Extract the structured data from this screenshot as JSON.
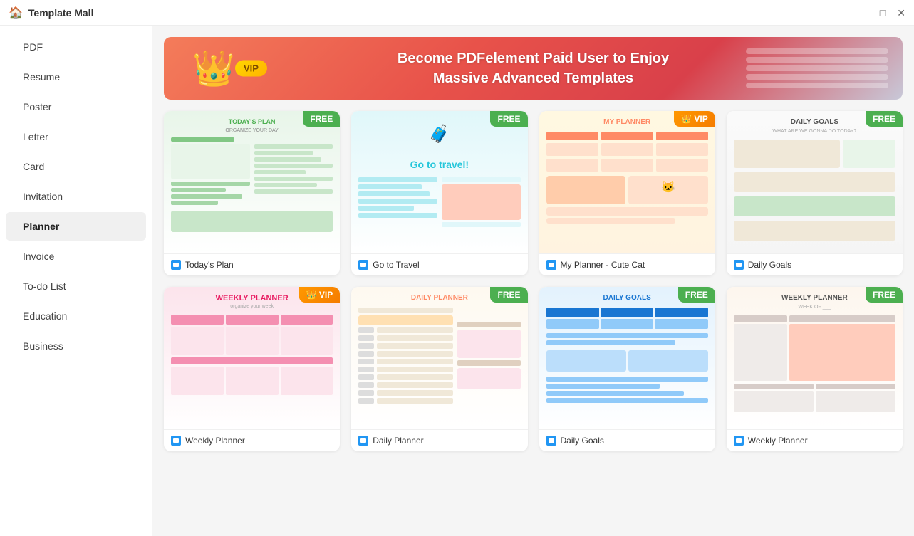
{
  "titlebar": {
    "title": "Template Mall",
    "icon": "🏠",
    "minimize": "—",
    "maximize": "□",
    "close": "✕"
  },
  "sidebar": {
    "items": [
      {
        "id": "pdf",
        "label": "PDF",
        "active": false
      },
      {
        "id": "resume",
        "label": "Resume",
        "active": false
      },
      {
        "id": "poster",
        "label": "Poster",
        "active": false
      },
      {
        "id": "letter",
        "label": "Letter",
        "active": false
      },
      {
        "id": "card",
        "label": "Card",
        "active": false
      },
      {
        "id": "invitation",
        "label": "Invitation",
        "active": false
      },
      {
        "id": "planner",
        "label": "Planner",
        "active": true
      },
      {
        "id": "invoice",
        "label": "Invoice",
        "active": false
      },
      {
        "id": "todo",
        "label": "To-do List",
        "active": false
      },
      {
        "id": "education",
        "label": "Education",
        "active": false
      },
      {
        "id": "business",
        "label": "Business",
        "active": false
      }
    ]
  },
  "banner": {
    "text_line1": "Become PDFelement Paid User to Enjoy",
    "text_line2": "Massive Advanced Templates",
    "vip_label": "VIP"
  },
  "templates": {
    "row1": [
      {
        "id": "todays-plan",
        "name": "Today's Plan",
        "badge": "FREE",
        "badge_type": "free"
      },
      {
        "id": "go-to-travel",
        "name": "Go to Travel",
        "badge": "FREE",
        "badge_type": "free"
      },
      {
        "id": "my-planner-cute-cat",
        "name": "My Planner - Cute Cat",
        "badge": "VIP",
        "badge_type": "vip"
      },
      {
        "id": "daily-goals",
        "name": "Daily Goals",
        "badge": "FREE",
        "badge_type": "free"
      }
    ],
    "row2": [
      {
        "id": "weekly-planner-vip",
        "name": "Weekly Planner",
        "badge": "VIP",
        "badge_type": "vip"
      },
      {
        "id": "daily-planner",
        "name": "Daily Planner",
        "badge": "FREE",
        "badge_type": "free"
      },
      {
        "id": "daily-goals-2",
        "name": "Daily Goals",
        "badge": "FREE",
        "badge_type": "free"
      },
      {
        "id": "weekly-planner-2",
        "name": "Weekly Planner",
        "badge": "FREE",
        "badge_type": "free"
      }
    ]
  }
}
